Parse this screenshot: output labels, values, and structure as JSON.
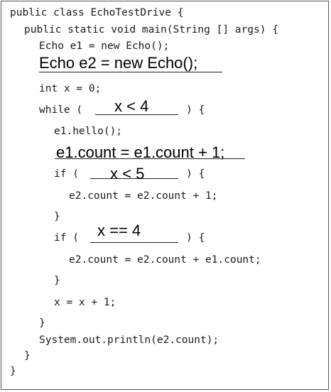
{
  "lines": {
    "l1": "public class EchoTestDrive {",
    "l2": "public static void main(String [] args) {",
    "l3": "Echo e1 = new Echo();",
    "l5": "int x = 0;",
    "l6_open": "while (",
    "l6_close": ") {",
    "l7": "e1.hello();",
    "l9_open": "if (",
    "l9_close": ") {",
    "l10": "e2.count = e2.count + 1;",
    "l11": "}",
    "l12_open": "if (",
    "l12_close": ") {",
    "l13": "e2.count = e2.count + e1.count;",
    "l14": "}",
    "l15": "x = x + 1;",
    "l16": "}",
    "l17": "System.out.println(e2.count);",
    "l18": "}",
    "l19": "}"
  },
  "blanks": {
    "b1": "Echo e2 = new Echo();",
    "b2": "x < 4",
    "b3": "e1.count = e1.count + 1;",
    "b4": "x < 5",
    "b5": "x == 4"
  }
}
